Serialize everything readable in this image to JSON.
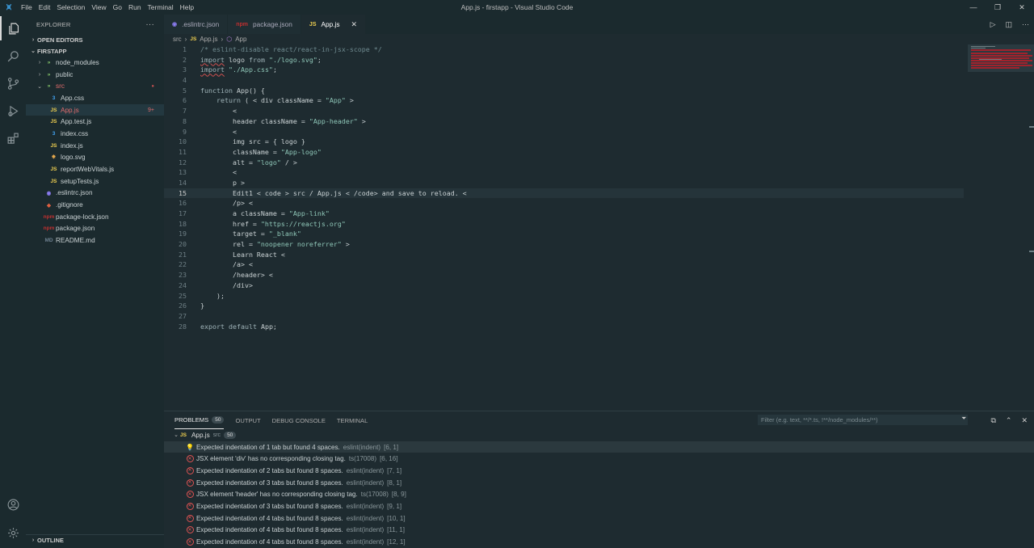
{
  "titlebar": {
    "logo": "⩙",
    "menu": [
      "File",
      "Edit",
      "Selection",
      "View",
      "Go",
      "Run",
      "Terminal",
      "Help"
    ],
    "title": "App.js - firstapp - Visual Studio Code"
  },
  "sidebar": {
    "title": "EXPLORER",
    "open_editors": "OPEN EDITORS",
    "project": "FIRSTAPP",
    "outline": "OUTLINE",
    "tree": [
      {
        "label": "node_modules",
        "icon": "»",
        "color": "#8ccf6e",
        "depth": 1,
        "folder": true
      },
      {
        "label": "public",
        "icon": "»",
        "color": "#8ccf6e",
        "depth": 1,
        "folder": true
      },
      {
        "label": "src",
        "icon": "»",
        "color": "#8ccf6e",
        "depth": 1,
        "folder": true,
        "open": true,
        "labelColor": "#e06c6c",
        "dot": true
      },
      {
        "label": "App.css",
        "icon": "3",
        "color": "#42a5f5",
        "depth": 2
      },
      {
        "label": "App.js",
        "icon": "JS",
        "color": "#f0d050",
        "depth": 2,
        "labelColor": "#e06c6c",
        "badge": "9+",
        "selected": true
      },
      {
        "label": "App.test.js",
        "icon": "JS",
        "color": "#f0d050",
        "depth": 2
      },
      {
        "label": "index.css",
        "icon": "3",
        "color": "#42a5f5",
        "depth": 2
      },
      {
        "label": "index.js",
        "icon": "JS",
        "color": "#f0d050",
        "depth": 2
      },
      {
        "label": "logo.svg",
        "icon": "⎈",
        "color": "#f0b050",
        "depth": 2
      },
      {
        "label": "reportWebVitals.js",
        "icon": "JS",
        "color": "#f0d050",
        "depth": 2
      },
      {
        "label": "setupTests.js",
        "icon": "JS",
        "color": "#f0d050",
        "depth": 2
      },
      {
        "label": ".eslintrc.json",
        "icon": "◉",
        "color": "#8b7cf0",
        "depth": 1
      },
      {
        "label": ".gitignore",
        "icon": "◆",
        "color": "#e06040",
        "depth": 1
      },
      {
        "label": "package-lock.json",
        "icon": "npm",
        "color": "#c03030",
        "depth": 1
      },
      {
        "label": "package.json",
        "icon": "npm",
        "color": "#c03030",
        "depth": 1
      },
      {
        "label": "README.md",
        "icon": "MD",
        "color": "#6e8090",
        "depth": 1
      }
    ]
  },
  "tabs": [
    {
      "label": ".eslintrc.json",
      "icon": "◉",
      "color": "#8b7cf0"
    },
    {
      "label": "package.json",
      "icon": "npm",
      "color": "#c03030"
    },
    {
      "label": "App.js",
      "icon": "JS",
      "color": "#f0d050",
      "active": true
    }
  ],
  "breadcrumbs": {
    "folder": "src",
    "file": "App.js",
    "symbol": "App"
  },
  "code_lines": [
    "/* eslint-disable react/react-in-jsx-scope */",
    "import logo from \"./logo.svg\";",
    "import \"./App.css\";",
    "",
    "function App() {",
    "    return ( < div className = \"App\" >",
    "        <",
    "        header className = \"App-header\" >",
    "        <",
    "        img src = { logo }",
    "        className = \"App-logo\"",
    "        alt = \"logo\" / >",
    "        <",
    "        p >",
    "        Edit1 < code > src / App.js < /code> and save to reload. <",
    "        /p> <",
    "        a className = \"App-link\"",
    "        href = \"https://reactjs.org\"",
    "        target = \"_blank\"",
    "        rel = \"noopener noreferrer\" >",
    "        Learn React <",
    "        /a> <",
    "        /header> <",
    "        /div>",
    "    );",
    "}",
    "",
    "export default App;"
  ],
  "current_line": 15,
  "panel": {
    "tabs": [
      {
        "label": "PROBLEMS",
        "badge": "50",
        "active": true
      },
      {
        "label": "OUTPUT"
      },
      {
        "label": "DEBUG CONSOLE"
      },
      {
        "label": "TERMINAL"
      }
    ],
    "filter_placeholder": "Filter (e.g. text, **/*.ts, !**/node_modules/**)",
    "file": {
      "name": "App.js",
      "folder": "src",
      "count": "50"
    },
    "problems": [
      {
        "type": "warn",
        "msg": "Expected indentation of 1 tab but found 4 spaces.",
        "src": "eslint(indent)",
        "pos": "[6, 1]",
        "selected": true
      },
      {
        "type": "err",
        "msg": "JSX element 'div' has no corresponding closing tag.",
        "src": "ts(17008)",
        "pos": "[6, 16]"
      },
      {
        "type": "err",
        "msg": "Expected indentation of 2 tabs but found 8 spaces.",
        "src": "eslint(indent)",
        "pos": "[7, 1]"
      },
      {
        "type": "err",
        "msg": "Expected indentation of 3 tabs but found 8 spaces.",
        "src": "eslint(indent)",
        "pos": "[8, 1]"
      },
      {
        "type": "err",
        "msg": "JSX element 'header' has no corresponding closing tag.",
        "src": "ts(17008)",
        "pos": "[8, 9]"
      },
      {
        "type": "err",
        "msg": "Expected indentation of 3 tabs but found 8 spaces.",
        "src": "eslint(indent)",
        "pos": "[9, 1]"
      },
      {
        "type": "err",
        "msg": "Expected indentation of 4 tabs but found 8 spaces.",
        "src": "eslint(indent)",
        "pos": "[10, 1]"
      },
      {
        "type": "err",
        "msg": "Expected indentation of 4 tabs but found 8 spaces.",
        "src": "eslint(indent)",
        "pos": "[11, 1]"
      },
      {
        "type": "err",
        "msg": "Expected indentation of 4 tabs but found 8 spaces.",
        "src": "eslint(indent)",
        "pos": "[12, 1]"
      }
    ]
  },
  "colors": {
    "accent": "#3c9dde",
    "error": "#e05353",
    "warning": "#e2c08d",
    "background": "#1e2b30"
  }
}
